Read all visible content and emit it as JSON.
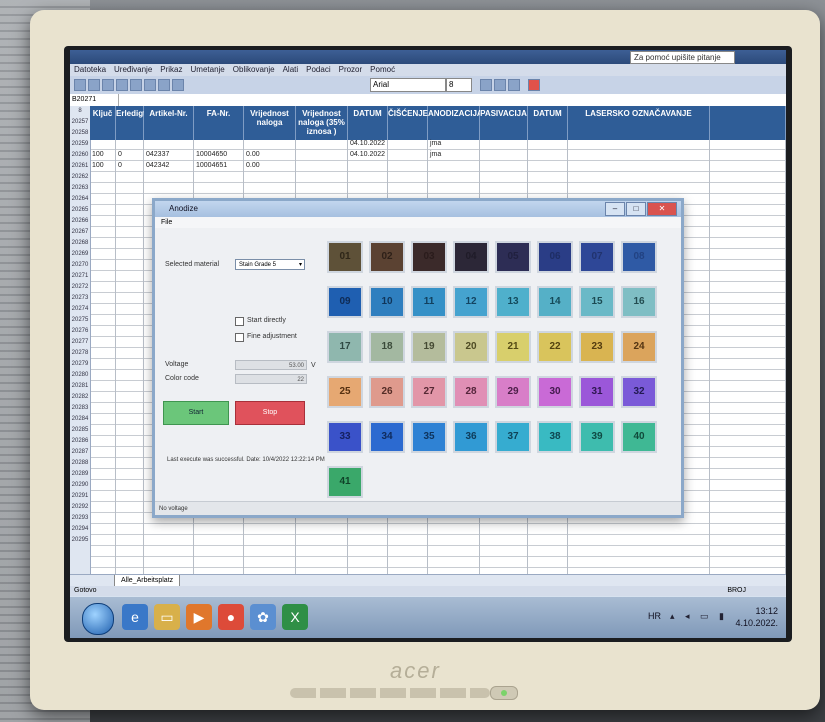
{
  "excel": {
    "help_placeholder": "Za pomoć upišite pitanje",
    "menu": [
      "Datoteka",
      "Uređivanje",
      "Prikaz",
      "Umetanje",
      "Oblikovanje",
      "Alati",
      "Podaci",
      "Prozor",
      "Pomoć"
    ],
    "font_name": "Arial",
    "font_size": "8",
    "name_box": "B20271",
    "headers": [
      {
        "id": "B",
        "label": "Ključ"
      },
      {
        "id": "C",
        "label": "Erledigt"
      },
      {
        "id": "D",
        "label": "Artikel-Nr."
      },
      {
        "id": "E",
        "label": "FA-Nr."
      },
      {
        "id": "J",
        "label": "Vrijednost naloga"
      },
      {
        "id": "K",
        "label": "Vrijednost naloga (35% iznosa )"
      },
      {
        "id": "M",
        "label": "DATUM"
      },
      {
        "id": "N",
        "label": "ČIŠĆENJE"
      },
      {
        "id": "P",
        "label": "ANODIZACIJA"
      },
      {
        "id": "Q",
        "label": "PASIVACIJA"
      },
      {
        "id": "R",
        "label": "DATUM"
      },
      {
        "id": "S",
        "label": "LASERSKO OZNAČAVANJE"
      },
      {
        "id": "T",
        "label": ""
      }
    ],
    "row_numbers": [
      "8",
      "20257",
      "20258",
      "20259",
      "20260",
      "20261",
      "20262",
      "20263",
      "20264",
      "20265",
      "20266",
      "20267",
      "20268",
      "20269",
      "20270",
      "20271",
      "20272",
      "20273",
      "20274",
      "20275",
      "20276",
      "20277",
      "20278",
      "20279",
      "20280",
      "20281",
      "20282",
      "20283",
      "20284",
      "20285",
      "20286",
      "20287",
      "20288",
      "20289",
      "20290",
      "20291",
      "20292",
      "20293",
      "20294",
      "20295"
    ],
    "visible_cells": [
      {
        "c": "D",
        "r": 1,
        "v": "042337"
      },
      {
        "c": "E",
        "r": 1,
        "v": "10004650"
      },
      {
        "c": "J",
        "r": 1,
        "v": "0.00"
      },
      {
        "c": "M",
        "r": 0,
        "v": "04.10.2022"
      },
      {
        "c": "M",
        "r": 1,
        "v": "04.10.2022"
      },
      {
        "c": "P",
        "r": 0,
        "v": "jma"
      },
      {
        "c": "P",
        "r": 1,
        "v": "jma"
      },
      {
        "c": "D",
        "r": 2,
        "v": "042342"
      },
      {
        "c": "E",
        "r": 2,
        "v": "10004651"
      },
      {
        "c": "J",
        "r": 2,
        "v": "0.00"
      },
      {
        "c": "B",
        "r": 1,
        "v": "100"
      },
      {
        "c": "C",
        "r": 1,
        "v": "0"
      },
      {
        "c": "B",
        "r": 2,
        "v": "100"
      },
      {
        "c": "C",
        "r": 2,
        "v": "0"
      }
    ],
    "sheet_tab": "Alle_Arbeitsplatz",
    "status_left": "Gotovo",
    "status_right": "BROJ"
  },
  "taskbar": {
    "language": "HR",
    "time": "13:12",
    "date": "4.10.2022."
  },
  "dialog": {
    "title": "Anodize",
    "menu_file": "File",
    "selected_material_label": "Selected material",
    "selected_material_value": "Stain Grade 5",
    "start_directly_label": "Start directly",
    "fine_adjustment_label": "Fine adjustment",
    "voltage_label": "Voltage",
    "voltage_value": "53.00",
    "voltage_unit": "V",
    "color_code_label": "Color code",
    "color_code_value": "22",
    "start_button": "Start",
    "stop_button": "Stop",
    "last_message": "Last execute was successful. Date: 10/4/2022 12:22:14 PM",
    "status_bar": "No voltage",
    "swatches": [
      {
        "label": "01",
        "color": "#5e5138",
        "text": "#2e2618"
      },
      {
        "label": "02",
        "color": "#5b4232",
        "text": "#2e2018"
      },
      {
        "label": "03",
        "color": "#3b2a2a",
        "text": "#2a1c1c"
      },
      {
        "label": "04",
        "color": "#2c2737",
        "text": "#1f1b28"
      },
      {
        "label": "05",
        "color": "#2d2d55",
        "text": "#20203f"
      },
      {
        "label": "06",
        "color": "#2a3d86",
        "text": "#1e2d64"
      },
      {
        "label": "07",
        "color": "#2e4797",
        "text": "#21336e"
      },
      {
        "label": "08",
        "color": "#2f5aa5",
        "text": "#224282"
      },
      {
        "label": "09",
        "color": "#1f5fb1",
        "text": "#0f2b55"
      },
      {
        "label": "10",
        "color": "#2f7fbf",
        "text": "#10355a"
      },
      {
        "label": "11",
        "color": "#3591c7",
        "text": "#12405e"
      },
      {
        "label": "12",
        "color": "#45a3cf",
        "text": "#134462"
      },
      {
        "label": "13",
        "color": "#4fb0cc",
        "text": "#134a5c"
      },
      {
        "label": "14",
        "color": "#55b0c7",
        "text": "#154a58"
      },
      {
        "label": "15",
        "color": "#6ab9c7",
        "text": "#1c4a52"
      },
      {
        "label": "16",
        "color": "#7fbec4",
        "text": "#234c50"
      },
      {
        "label": "17",
        "color": "#8fb7ae",
        "text": "#2f4a44"
      },
      {
        "label": "18",
        "color": "#a3b8a1",
        "text": "#3a4a39"
      },
      {
        "label": "19",
        "color": "#b4bc9c",
        "text": "#454a33"
      },
      {
        "label": "20",
        "color": "#c9c78e",
        "text": "#4e4b25"
      },
      {
        "label": "21",
        "color": "#d8cf6c",
        "text": "#534a14"
      },
      {
        "label": "22",
        "color": "#d9c45c",
        "text": "#534310"
      },
      {
        "label": "23",
        "color": "#d9b451",
        "text": "#533c10"
      },
      {
        "label": "24",
        "color": "#dba45c",
        "text": "#533412"
      },
      {
        "label": "25",
        "color": "#e6a872",
        "text": "#553010"
      },
      {
        "label": "26",
        "color": "#df9a8d",
        "text": "#542c26"
      },
      {
        "label": "27",
        "color": "#e296a8",
        "text": "#552834"
      },
      {
        "label": "28",
        "color": "#e08fb5",
        "text": "#54243a"
      },
      {
        "label": "29",
        "color": "#d87ec8",
        "text": "#4c1f48"
      },
      {
        "label": "30",
        "color": "#c96ad6",
        "text": "#421a4c"
      },
      {
        "label": "31",
        "color": "#9b57d9",
        "text": "#2e1650"
      },
      {
        "label": "32",
        "color": "#7a5ad8",
        "text": "#221a52"
      },
      {
        "label": "33",
        "color": "#3a52c9",
        "text": "#152060"
      },
      {
        "label": "34",
        "color": "#2c6ad0",
        "text": "#0f2a5c"
      },
      {
        "label": "35",
        "color": "#2f82d4",
        "text": "#0e335c"
      },
      {
        "label": "36",
        "color": "#319ad4",
        "text": "#0e3b5a"
      },
      {
        "label": "37",
        "color": "#36acd0",
        "text": "#0e4258"
      },
      {
        "label": "38",
        "color": "#39bac2",
        "text": "#0e4650"
      },
      {
        "label": "39",
        "color": "#3ebcae",
        "text": "#0f4a44"
      },
      {
        "label": "40",
        "color": "#3fb894",
        "text": "#104a3a"
      },
      {
        "label": "41",
        "color": "#3aa86a",
        "text": "#0f4228"
      }
    ]
  },
  "monitor": {
    "brand": "acer"
  }
}
